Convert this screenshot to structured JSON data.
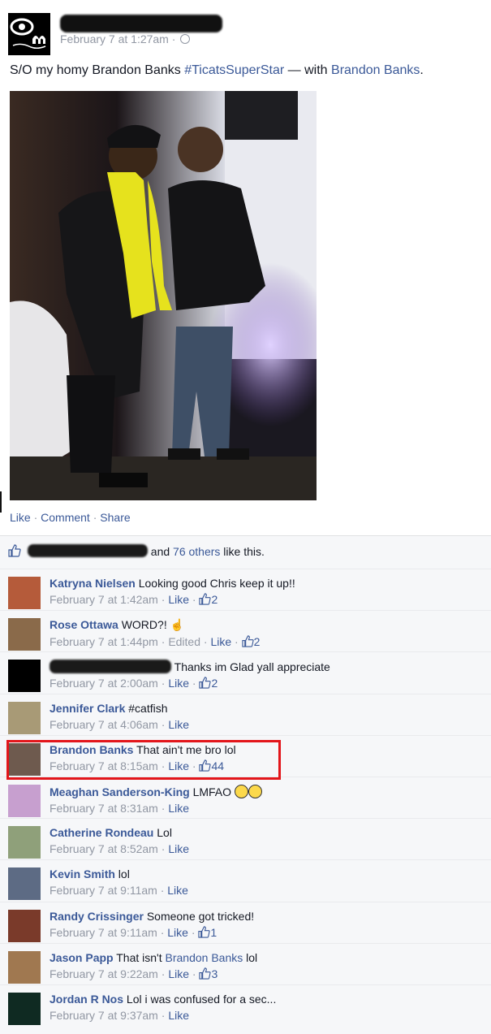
{
  "post": {
    "time": "February 7 at 1:27am",
    "separator": "·",
    "text_prefix": "S/O my homy Brandon Banks ",
    "hashtag": "#TicatsSuperStar",
    "text_with": " — with ",
    "tagged": "Brandon Banks",
    "text_end": ".",
    "actions": {
      "like": "Like",
      "comment": "Comment",
      "share": "Share"
    }
  },
  "likes": {
    "and": "and",
    "others": "76 others",
    "suffix": "like this."
  },
  "comments": [
    {
      "name": "Katryna Nielsen",
      "text": "Looking good Chris keep it up!!",
      "time": "February 7 at 1:42am",
      "like": "Like",
      "count": "2",
      "avatar": "#b55b3a"
    },
    {
      "name": "Rose Ottawa",
      "text": "WORD?!",
      "time": "February 7 at 1:44pm",
      "edited": "Edited",
      "like": "Like",
      "count": "2",
      "avatar": "#8a6a4a"
    },
    {
      "name": "",
      "text": "Thanks im Glad yall appreciate",
      "time": "February 7 at 2:00am",
      "like": "Like",
      "count": "2",
      "avatar": "#000000"
    },
    {
      "name": "Jennifer Clark",
      "text": "#catfish",
      "time": "February 7 at 4:06am",
      "like": "Like",
      "count": "",
      "avatar": "#a89a76"
    },
    {
      "name": "Brandon Banks",
      "text": "That ain't me bro lol",
      "time": "February 7 at 8:15am",
      "like": "Like",
      "count": "44",
      "avatar": "#6e5a4e"
    },
    {
      "name": "Meaghan Sanderson-King",
      "text": "LMFAO",
      "time": "February 7 at 8:31am",
      "like": "Like",
      "count": "",
      "avatar": "#c79fcf"
    },
    {
      "name": "Catherine Rondeau",
      "text": "Lol",
      "time": "February 7 at 8:52am",
      "like": "Like",
      "count": "",
      "avatar": "#8fa07a"
    },
    {
      "name": "Kevin Smith",
      "text": "lol",
      "time": "February 7 at 9:11am",
      "like": "Like",
      "count": "",
      "avatar": "#5d6b84"
    },
    {
      "name": "Randy Crissinger",
      "text": "Someone got tricked!",
      "time": "February 7 at 9:11am",
      "like": "Like",
      "count": "1",
      "avatar": "#7a3a2a"
    },
    {
      "name": "Jason Papp",
      "text": "That isn't ",
      "text_link": "Brandon Banks",
      "text_end": " lol",
      "time": "February 7 at 9:22am",
      "like": "Like",
      "count": "3",
      "avatar": "#a07850"
    },
    {
      "name": "Jordan R Nos",
      "text": "Lol i was confused for a sec...",
      "time": "February 7 at 9:37am",
      "like": "Like",
      "count": "",
      "avatar": "#0f2a22"
    }
  ],
  "colors": {
    "link": "#3b5998",
    "muted": "#9197a3",
    "highlight": "#e3161b",
    "ufi_bg": "#f6f7f9"
  }
}
